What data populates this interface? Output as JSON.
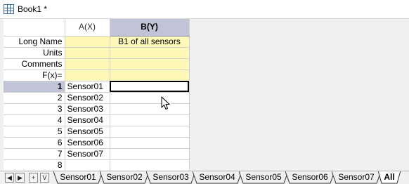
{
  "window": {
    "title": "Book1 *"
  },
  "columns": {
    "a": {
      "header": "A(X)"
    },
    "b": {
      "header": "B(Y)"
    }
  },
  "meta_rows": [
    {
      "label": "Long Name",
      "a": "",
      "b": "B1 of all sensors"
    },
    {
      "label": "Units",
      "a": "",
      "b": ""
    },
    {
      "label": "Comments",
      "a": "",
      "b": ""
    },
    {
      "label": "F(x)=",
      "a": "",
      "b": ""
    }
  ],
  "rows": [
    {
      "num": "1",
      "a": "Sensor01",
      "b": ""
    },
    {
      "num": "2",
      "a": "Sensor02",
      "b": ""
    },
    {
      "num": "3",
      "a": "Sensor03",
      "b": ""
    },
    {
      "num": "4",
      "a": "Sensor04",
      "b": ""
    },
    {
      "num": "5",
      "a": "Sensor05",
      "b": ""
    },
    {
      "num": "6",
      "a": "Sensor06",
      "b": ""
    },
    {
      "num": "7",
      "a": "Sensor07",
      "b": ""
    },
    {
      "num": "8",
      "a": "",
      "b": ""
    }
  ],
  "nav_buttons": [
    {
      "icon": "first-sheet-icon",
      "glyph": "◀"
    },
    {
      "icon": "last-sheet-icon",
      "glyph": "▶"
    },
    {
      "icon": "add-sheet-icon",
      "glyph": "+"
    },
    {
      "icon": "sheet-list-icon",
      "glyph": "V"
    }
  ],
  "tabs": [
    {
      "label": "Sensor01"
    },
    {
      "label": "Sensor02"
    },
    {
      "label": "Sensor03"
    },
    {
      "label": "Sensor04"
    },
    {
      "label": "Sensor05"
    },
    {
      "label": "Sensor06"
    },
    {
      "label": "Sensor07"
    },
    {
      "label": "All"
    }
  ],
  "colors": {
    "meta_bg": "#fdf7b8",
    "selected_header_bg": "#c0c4d6"
  }
}
